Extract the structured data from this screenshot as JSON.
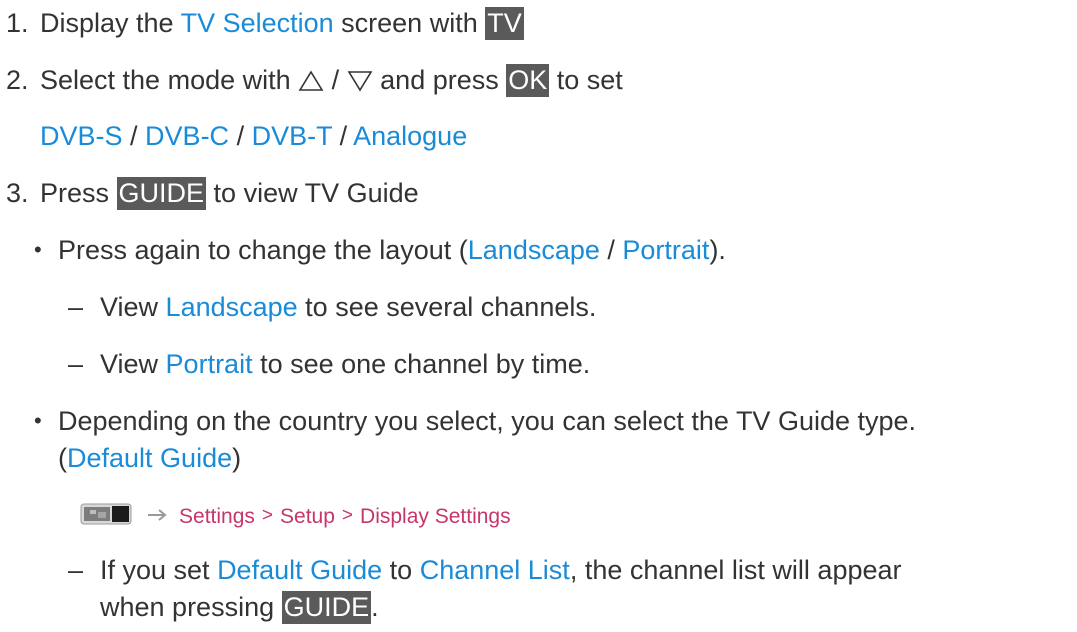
{
  "step1": {
    "number": "1.",
    "text_a": "Display the ",
    "link": "TV Selection",
    "text_b": " screen with ",
    "key": "TV"
  },
  "step2": {
    "number": "2.",
    "text_a": "Select the mode with ",
    "up_icon": "up-triangle-icon",
    "slash": " / ",
    "down_icon": "down-triangle-icon",
    "text_b": " and press ",
    "key": "OK",
    "text_c": " to set",
    "modes": [
      "DVB-S",
      "DVB-C",
      "DVB-T",
      "Analogue"
    ],
    "separator": " / "
  },
  "step3": {
    "number": "3.",
    "text_a": "Press ",
    "key": "GUIDE",
    "text_b": " to view TV Guide"
  },
  "bullet1": {
    "symbol": "•",
    "text_a": "Press again to change the layout (",
    "link_a": "Landscape",
    "slash": " / ",
    "link_b": "Portrait",
    "text_b": ")."
  },
  "sub1": {
    "dash": "–",
    "text_a": "View ",
    "link": "Landscape",
    "text_b": " to see several channels."
  },
  "sub2": {
    "dash": "–",
    "text_a": "View ",
    "link": "Portrait",
    "text_b": " to see one channel by time."
  },
  "bullet2": {
    "symbol": "•",
    "text_a": "Depending on the country you select, you can select the TV Guide type.",
    "paren_open": "(",
    "link": "Default Guide",
    "paren_close": ")"
  },
  "menu_path": {
    "icon": "tv-menu-icon",
    "arrow_icon": "right-arrow-icon",
    "items": [
      "Settings",
      "Setup",
      "Display Settings"
    ],
    "separator": ">"
  },
  "sub3": {
    "dash": "–",
    "text_a": "If you set ",
    "link_a": "Default Guide",
    "text_b": " to ",
    "link_b": "Channel List",
    "text_c": ", the channel list will appear",
    "text_d": "when pressing ",
    "key": "GUIDE",
    "text_e": "."
  },
  "colors": {
    "link": "#1a8bd8",
    "menu_path": "#c8356b",
    "key_bg": "#5a5a5a",
    "text": "#333333"
  }
}
